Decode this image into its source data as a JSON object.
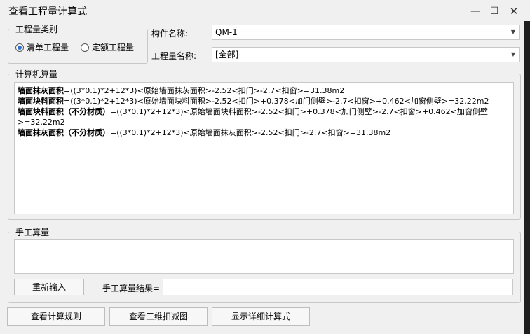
{
  "window": {
    "title": "查看工程量计算式"
  },
  "category_group": {
    "label": "工程量类别",
    "options": [
      {
        "label": "清单工程量",
        "checked": true
      },
      {
        "label": "定额工程量",
        "checked": false
      }
    ]
  },
  "component": {
    "label": "构件名称:",
    "value": "QM-1"
  },
  "quantity": {
    "label": "工程量名称:",
    "value": "[全部]"
  },
  "computer_calc": {
    "label": "计算机算量",
    "lines": [
      {
        "name": "墙面抹灰面积",
        "formula": "=((3*0.1)*2+12*3)<原始墙面抹灰面积>-2.52<扣门>-2.7<扣窗>=31.38m2"
      },
      {
        "name": "墙面块料面积",
        "formula": "=((3*0.1)*2+12*3)<原始墙面块料面积>-2.52<扣门>+0.378<加门侧壁>-2.7<扣窗>+0.462<加窗侧壁>=32.22m2"
      },
      {
        "name": "墙面块料面积（不分材质）",
        "formula": "=((3*0.1)*2+12*3)<原始墙面块料面积>-2.52<扣门>+0.378<加门侧壁>-2.7<扣窗>+0.462<加窗侧壁>=32.22m2"
      },
      {
        "name": "墙面抹灰面积（不分材质）",
        "formula": "=((3*0.1)*2+12*3)<原始墙面抹灰面积>-2.52<扣门>-2.7<扣窗>=31.38m2"
      }
    ]
  },
  "manual_calc": {
    "label": "手工算量",
    "reenter_label": "重新输入",
    "result_label": "手工算量结果="
  },
  "footer": {
    "rules_label": "查看计算规则",
    "view3d_label": "查看三维扣减图",
    "detail_label": "显示详细计算式"
  }
}
